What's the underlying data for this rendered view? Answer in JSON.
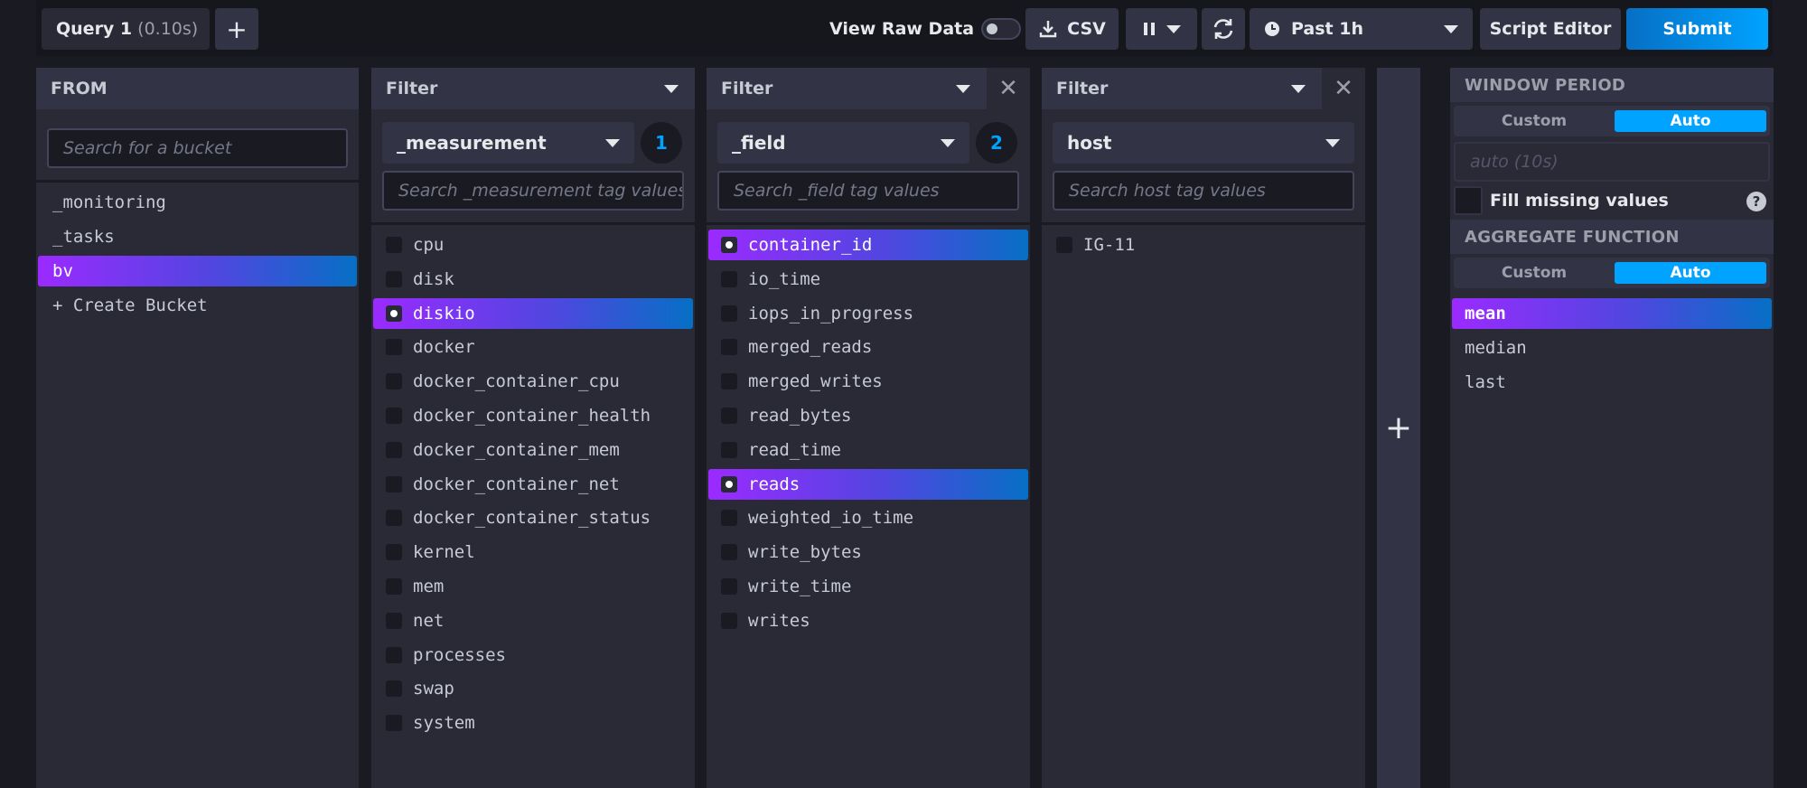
{
  "toolbar": {
    "query_label": "Query 1",
    "query_time": "(0.10s)",
    "add_query": "+",
    "view_raw_label": "View Raw Data",
    "csv_label": "CSV",
    "time_range": "Past 1h",
    "script_editor": "Script Editor",
    "submit": "Submit"
  },
  "from_panel": {
    "title": "FROM",
    "search_placeholder": "Search for a bucket",
    "buckets": [
      "_monitoring",
      "_tasks",
      "bv",
      "+ Create Bucket"
    ],
    "selected": "bv"
  },
  "filter1": {
    "title": "Filter",
    "key": "_measurement",
    "count": "1",
    "search_placeholder": "Search _measurement tag values",
    "values": [
      "cpu",
      "disk",
      "diskio",
      "docker",
      "docker_container_cpu",
      "docker_container_health",
      "docker_container_mem",
      "docker_container_net",
      "docker_container_status",
      "kernel",
      "mem",
      "net",
      "processes",
      "swap",
      "system"
    ],
    "selected": [
      "diskio"
    ]
  },
  "filter2": {
    "title": "Filter",
    "key": "_field",
    "count": "2",
    "search_placeholder": "Search _field tag values",
    "values": [
      "container_id",
      "io_time",
      "iops_in_progress",
      "merged_reads",
      "merged_writes",
      "read_bytes",
      "read_time",
      "reads",
      "weighted_io_time",
      "write_bytes",
      "write_time",
      "writes"
    ],
    "selected": [
      "container_id",
      "reads"
    ]
  },
  "filter3": {
    "title": "Filter",
    "key": "host",
    "search_placeholder": "Search host tag values",
    "values": [
      "IG-11"
    ],
    "selected": []
  },
  "add_filter": "+",
  "aggregate": {
    "window_title": "WINDOW PERIOD",
    "window_custom": "Custom",
    "window_auto": "Auto",
    "window_placeholder": "auto (10s)",
    "fill_missing": "Fill missing values",
    "help": "?",
    "func_title": "AGGREGATE FUNCTION",
    "func_custom": "Custom",
    "func_auto": "Auto",
    "functions": [
      "mean",
      "median",
      "last"
    ],
    "selected": "mean"
  }
}
